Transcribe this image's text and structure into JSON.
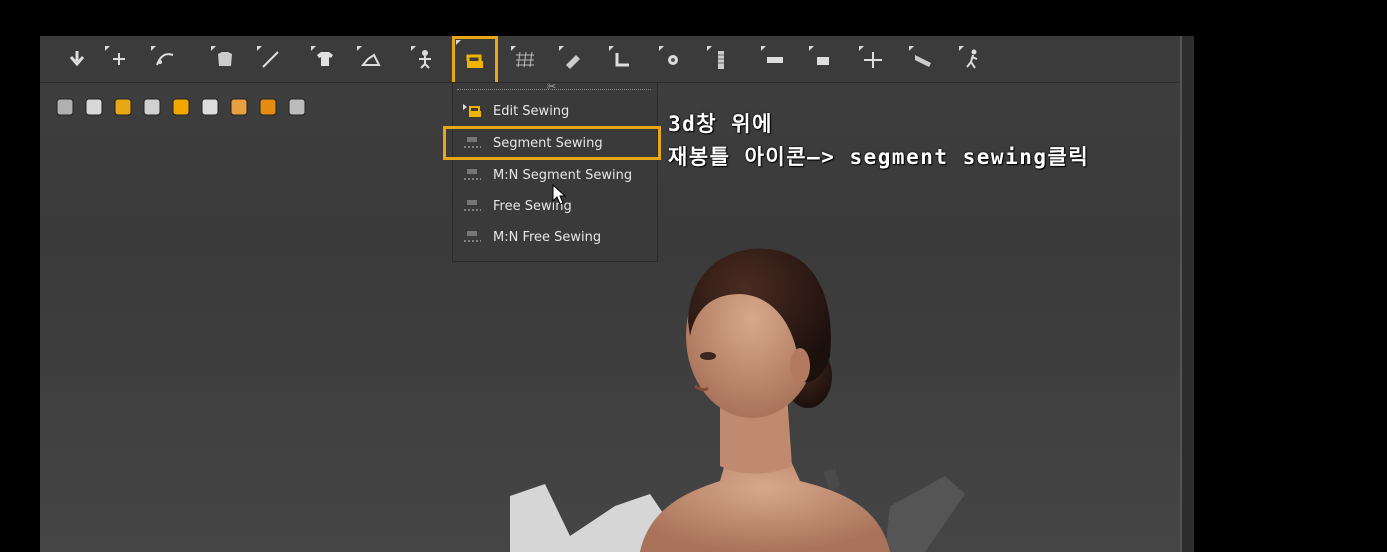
{
  "colors": {
    "highlight": "#e8a815",
    "menu_text": "#e6e6e6",
    "viewport": "#3f3f3f"
  },
  "toolbar": {
    "icons": [
      "down-arrow-icon",
      "add-point-icon",
      "edit-curve-icon",
      "garment-icon",
      "needle-icon",
      "shirt-icon",
      "fold-icon",
      "avatar-pose-icon",
      "sewing-machine-icon",
      "grid-icon",
      "brush-icon",
      "tack-icon",
      "pin-icon",
      "zipper-icon",
      "tape-icon",
      "button-icon",
      "measure-icon",
      "ruler-icon",
      "walk-icon"
    ],
    "active_icon": "sewing-machine-icon"
  },
  "subbar": {
    "icons": [
      "fabric-icon",
      "shirt-icon",
      "texture-icon",
      "avatar-icon",
      "paint-icon",
      "fold-icon",
      "skin-icon",
      "globe-icon",
      "export-icon"
    ]
  },
  "menu": {
    "items": [
      {
        "label": "Edit Sewing",
        "icon": "edit-sewing-icon"
      },
      {
        "label": "Segment Sewing",
        "icon": "segment-sewing-icon"
      },
      {
        "label": "M:N Segment Sewing",
        "icon": "mn-segment-sewing-icon"
      },
      {
        "label": "Free Sewing",
        "icon": "free-sewing-icon"
      },
      {
        "label": "M:N Free Sewing",
        "icon": "mn-free-sewing-icon"
      }
    ],
    "highlighted": "Segment Sewing"
  },
  "annotation": {
    "line1": "3d창 위에",
    "line2": "재봉틀 아이콘—> segment sewing클릭"
  }
}
